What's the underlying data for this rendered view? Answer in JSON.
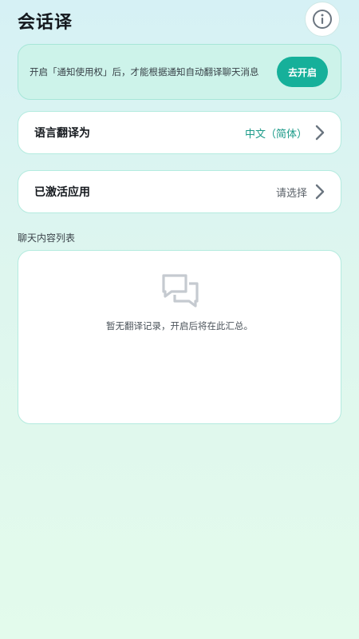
{
  "header": {
    "title": "会话译",
    "info_icon": "info-icon"
  },
  "banner": {
    "text": "开启「通知使用权」后，才能根据通知自动翻译聊天消息",
    "button_label": "去开启",
    "button_color": "#16b09a"
  },
  "settings": {
    "language": {
      "label": "语言翻译为",
      "value": "中文（简体）",
      "value_color": "#1a9a88",
      "chevron_icon": "chevron-right-icon"
    },
    "apps": {
      "label": "已激活应用",
      "value": "请选择",
      "value_color": "#5a6168",
      "chevron_icon": "chevron-right-icon"
    }
  },
  "chat_list": {
    "section_title": "聊天内容列表",
    "empty_icon": "chat-bubbles-icon",
    "empty_text": "暂无翻译记录，开启后将在此汇总。"
  },
  "colors": {
    "accent": "#16b09a",
    "card_border": "#b4ebdf",
    "banner_bg": "#cdf3ea"
  }
}
